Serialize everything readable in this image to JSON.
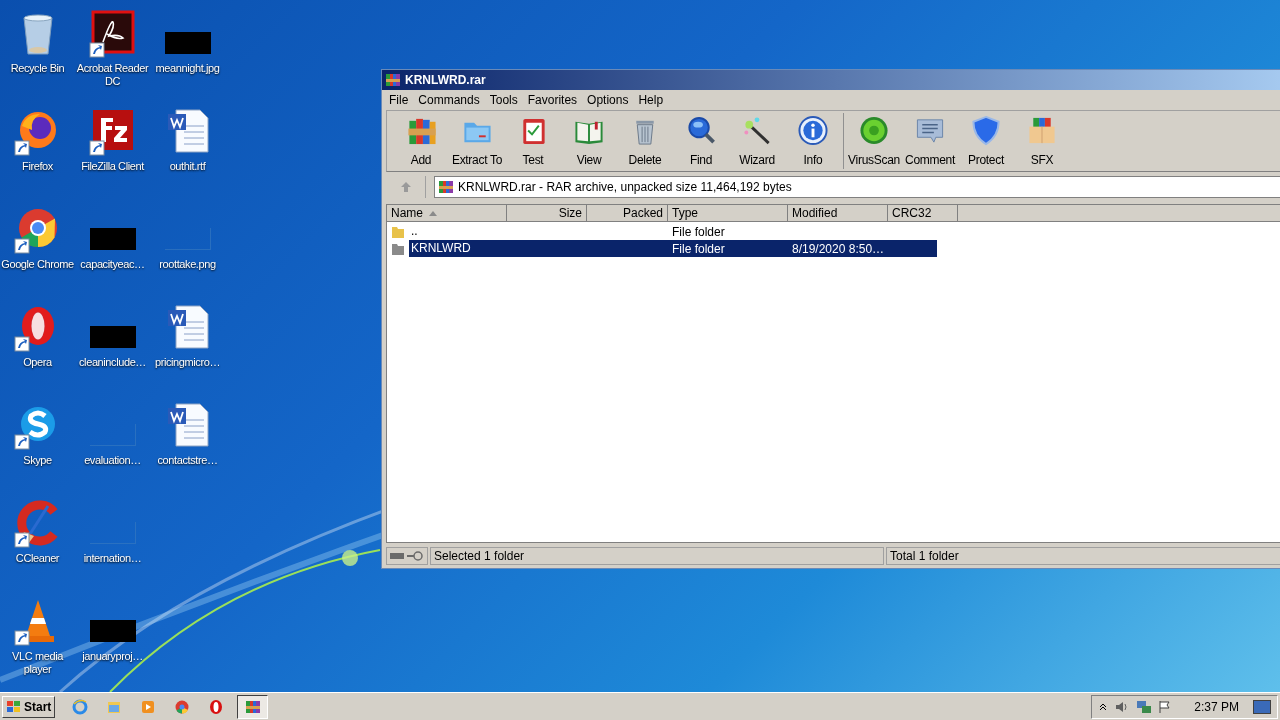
{
  "desktop": {
    "columns": [
      [
        {
          "label": "Recycle Bin",
          "kind": "app",
          "shortcut": false
        },
        {
          "label": "Firefox",
          "kind": "app",
          "shortcut": true
        },
        {
          "label": "Google Chrome",
          "kind": "app",
          "shortcut": true
        },
        {
          "label": "Opera",
          "kind": "app",
          "shortcut": true
        },
        {
          "label": "Skype",
          "kind": "app",
          "shortcut": true
        },
        {
          "label": "CCleaner",
          "kind": "app",
          "shortcut": true
        },
        {
          "label": "VLC media player",
          "kind": "app",
          "shortcut": true
        }
      ],
      [
        {
          "label": "Acrobat Reader DC",
          "kind": "app",
          "shortcut": true
        },
        {
          "label": "FileZilla Client",
          "kind": "app",
          "shortcut": true
        },
        {
          "label": "capacityeac…",
          "kind": "redacted"
        },
        {
          "label": "cleaninclude…",
          "kind": "redacted"
        },
        {
          "label": "evaluation…",
          "kind": "blank"
        },
        {
          "label": "internation…",
          "kind": "blank"
        },
        {
          "label": "januaryproj…",
          "kind": "redacted"
        }
      ],
      [
        {
          "label": "meannight.jpg",
          "kind": "redacted"
        },
        {
          "label": "outhit.rtf",
          "kind": "document"
        },
        {
          "label": "roottake.png",
          "kind": "blank"
        },
        {
          "label": "pricingmicro…",
          "kind": "document"
        },
        {
          "label": "contactstre…",
          "kind": "document"
        }
      ]
    ]
  },
  "window": {
    "title": "KRNLWRD.rar",
    "menu": [
      "File",
      "Commands",
      "Tools",
      "Favorites",
      "Options",
      "Help"
    ],
    "toolbar": [
      [
        "Add",
        "Extract To",
        "Test",
        "View",
        "Delete",
        "Find",
        "Wizard",
        "Info"
      ],
      [
        "VirusScan",
        "Comment",
        "Protect",
        "SFX"
      ]
    ],
    "address": "KRNLWRD.rar - RAR archive, unpacked size 11,464,192 bytes",
    "columns": [
      {
        "label": "Name",
        "sorted": true
      },
      {
        "label": "Size",
        "sorted": false
      },
      {
        "label": "Packed",
        "sorted": false
      },
      {
        "label": "Type",
        "sorted": false
      },
      {
        "label": "Modified",
        "sorted": false
      },
      {
        "label": "CRC32",
        "sorted": false
      }
    ],
    "rows": [
      {
        "name": "..",
        "kind": "parent",
        "type": "File folder",
        "selected": false
      },
      {
        "name": "KRNLWRD",
        "kind": "folder",
        "type": "File folder",
        "modified": "8/19/2020 8:50…",
        "selected": true
      }
    ],
    "status": {
      "left": "Selected 1 folder",
      "right": "Total 1 folder"
    }
  },
  "taskbar": {
    "start": "Start",
    "apps": [
      {
        "active": false
      },
      {
        "active": false
      },
      {
        "active": false
      },
      {
        "active": false
      },
      {
        "active": false
      },
      {
        "active": true
      }
    ],
    "clock": "2:37 PM"
  }
}
